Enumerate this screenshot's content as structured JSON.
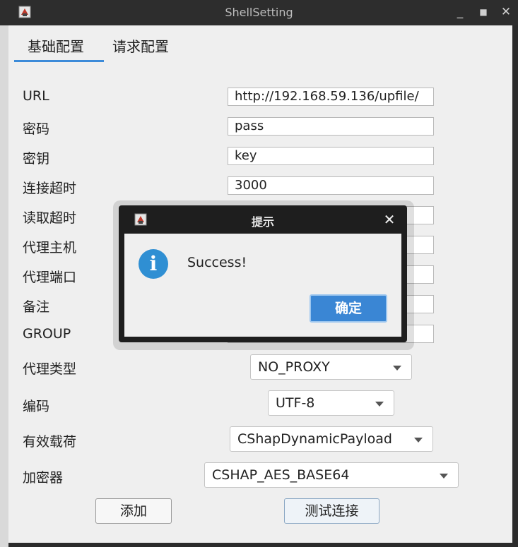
{
  "window": {
    "title": "ShellSetting",
    "controls": {
      "minimize": "_",
      "maximize": "■",
      "close": "✕"
    }
  },
  "tabs": [
    {
      "label": "基础配置",
      "active": true
    },
    {
      "label": "请求配置",
      "active": false
    }
  ],
  "form": {
    "url": {
      "label": "URL",
      "value": "http://192.168.59.136/upfile/"
    },
    "password": {
      "label": "密码",
      "value": "pass"
    },
    "key": {
      "label": "密钥",
      "value": "key"
    },
    "connect_timeout": {
      "label": "连接超时",
      "value": "3000"
    },
    "read_timeout": {
      "label": "读取超时",
      "value": ""
    },
    "proxy_host": {
      "label": "代理主机",
      "value": ""
    },
    "proxy_port": {
      "label": "代理端口",
      "value": ""
    },
    "remark": {
      "label": "备注",
      "value": ""
    },
    "group": {
      "label": "GROUP",
      "value": ""
    },
    "proxy_type": {
      "label": "代理类型",
      "selected": "NO_PROXY"
    },
    "encoding": {
      "label": "编码",
      "selected": "UTF-8"
    },
    "payload": {
      "label": "有效载荷",
      "selected": "CShapDynamicPayload"
    },
    "cryption": {
      "label": "加密器",
      "selected": "CSHAP_AES_BASE64"
    }
  },
  "buttons": {
    "add": "添加",
    "test": "测试连接"
  },
  "dialog": {
    "title": "提示",
    "message": "Success!",
    "ok_label": "确定",
    "close": "✕",
    "info_glyph": "i"
  },
  "colors": {
    "accent": "#3a86d4",
    "titlebar": "#2d2d2d",
    "panel": "#efefef",
    "info": "#2f8fd3"
  },
  "icons": [
    "app-icon",
    "info-icon",
    "close-icon",
    "minimize-icon",
    "maximize-icon",
    "dropdown-caret-icon"
  ]
}
